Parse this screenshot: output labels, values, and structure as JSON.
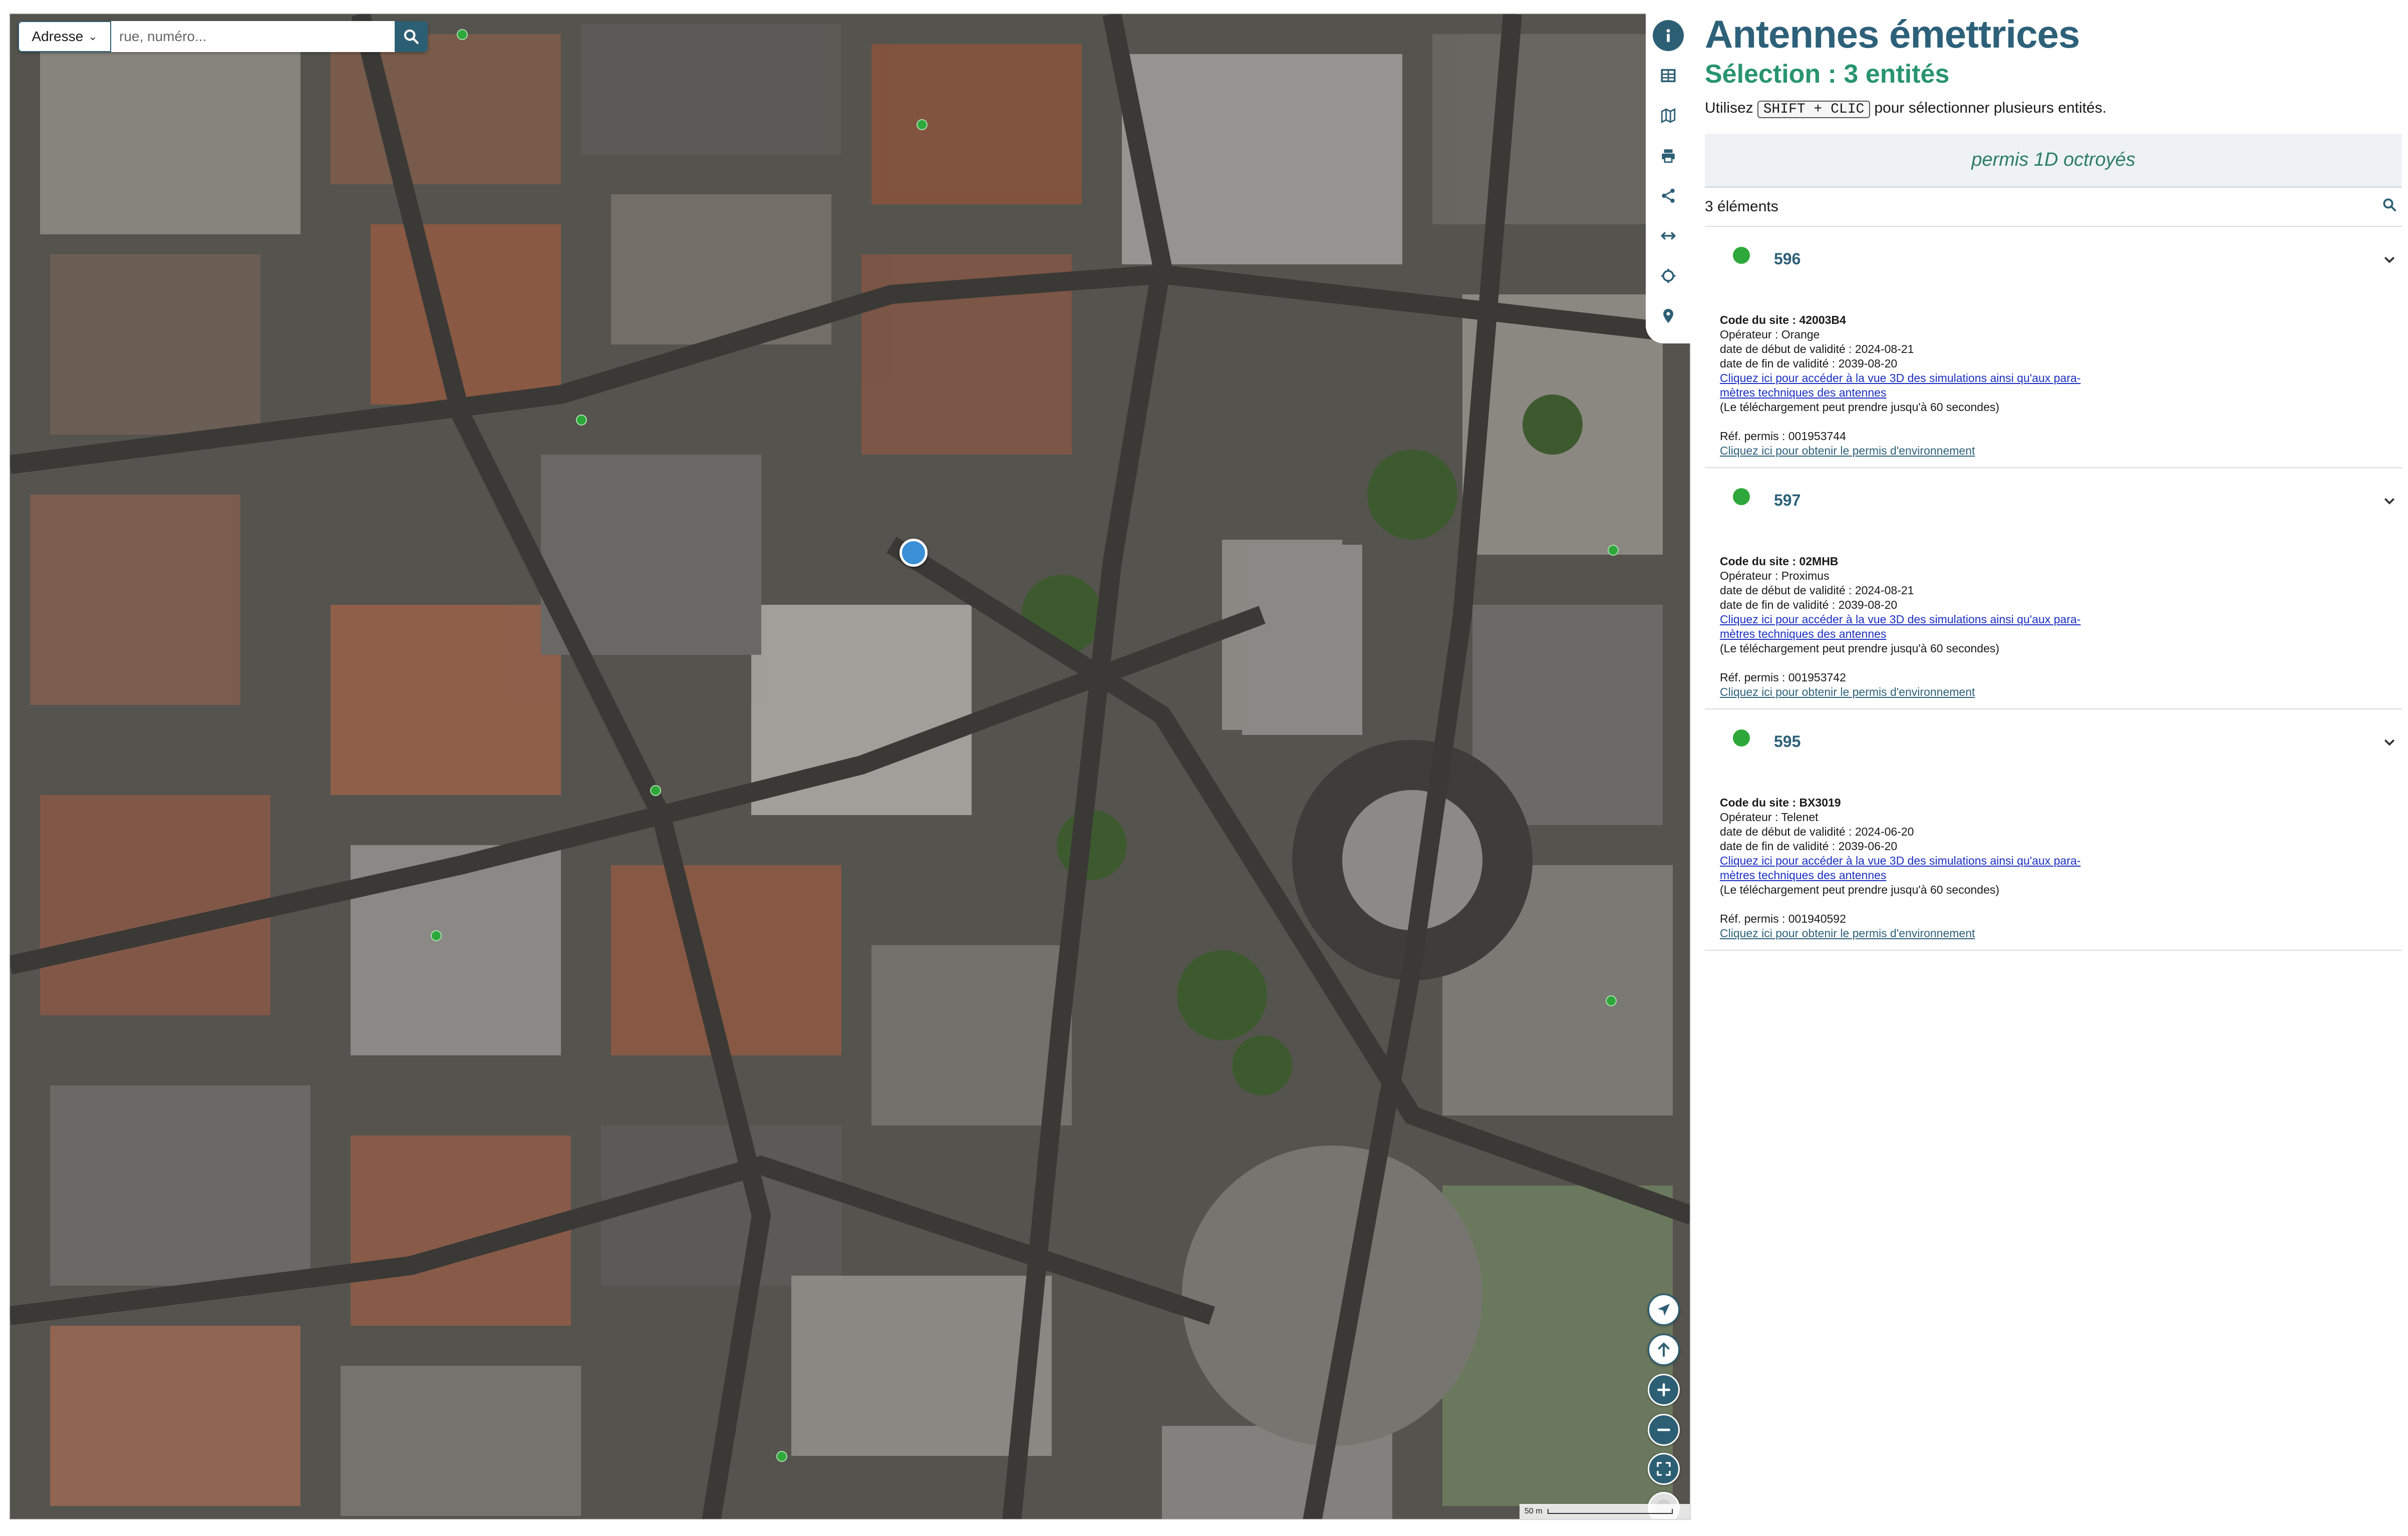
{
  "search": {
    "mode_label": "Adresse",
    "placeholder": "rue, numéro..."
  },
  "map": {
    "scale_label": "50 m"
  },
  "panel": {
    "title": "Antennes émettrices",
    "subtitle": "Sélection : 3 entités",
    "hint_before": "Utilisez",
    "hint_key": "SHIFT + CLIC",
    "hint_after": "pour sélectionner plusieurs entités.",
    "layer_name": "permis 1D octroyés",
    "count_label": "3 éléments"
  },
  "features": [
    {
      "id": "596",
      "site_code_label": "Code du site :",
      "site_code": "42003B4",
      "operator_label": "Opérateur :",
      "operator": "Orange",
      "start_label": "date de début de validité :",
      "start_date": "2024-08-21",
      "end_label": "date de fin de validité :",
      "end_date": "2039-08-20",
      "link3d_line1": "Cliquez ici pour accéder à la vue 3D des simulations ainsi qu'aux para-",
      "link3d_line2": "mètres techniques des antennes",
      "download_note": "(Le téléchargement peut prendre jusqu'à 60 secondes)",
      "ref_label": "Réf. permis :",
      "ref": "001953744",
      "env_link": "Cliquez ici pour obtenir le permis d'environnement"
    },
    {
      "id": "597",
      "site_code_label": "Code du site :",
      "site_code": "02MHB",
      "operator_label": "Opérateur :",
      "operator": "Proximus",
      "start_label": "date de début de validité :",
      "start_date": "2024-08-21",
      "end_label": "date de fin de validité :",
      "end_date": "2039-08-20",
      "link3d_line1": "Cliquez ici pour accéder à la vue 3D des simulations ainsi qu'aux para-",
      "link3d_line2": "mètres techniques des antennes",
      "download_note": "(Le téléchargement peut prendre jusqu'à 60 secondes)",
      "ref_label": "Réf. permis :",
      "ref": "001953742",
      "env_link": "Cliquez ici pour obtenir le permis d'environnement"
    },
    {
      "id": "595",
      "site_code_label": "Code du site :",
      "site_code": "BX3019",
      "operator_label": "Opérateur :",
      "operator": "Telenet",
      "start_label": "date de début de validité :",
      "start_date": "2024-06-20",
      "end_label": "date de fin de validité :",
      "end_date": "2039-06-20",
      "link3d_line1": "Cliquez ici pour accéder à la vue 3D des simulations ainsi qu'aux para-",
      "link3d_line2": "mètres techniques des antennes",
      "download_note": "(Le téléchargement peut prendre jusqu'à 60 secondes)",
      "ref_label": "Réf. permis :",
      "ref": "001940592",
      "env_link": "Cliquez ici pour obtenir le permis d'environnement"
    }
  ],
  "colors": {
    "accent": "#2d5f74",
    "title": "#2d6079",
    "subtitle": "#28946f",
    "feature_dot": "#2ea83a",
    "selected_marker": "#3a8fd6",
    "link": "#1a2ec2"
  },
  "icons": {
    "toolbar": [
      "info-icon",
      "table-icon",
      "map-icon",
      "print-icon",
      "share-icon",
      "measure-icon",
      "crosshair-icon",
      "pin-icon"
    ],
    "map_controls": [
      "locate-icon",
      "compass-north-icon",
      "zoom-in-icon",
      "zoom-out-icon",
      "fullscreen-icon",
      "basemap-icon"
    ]
  }
}
